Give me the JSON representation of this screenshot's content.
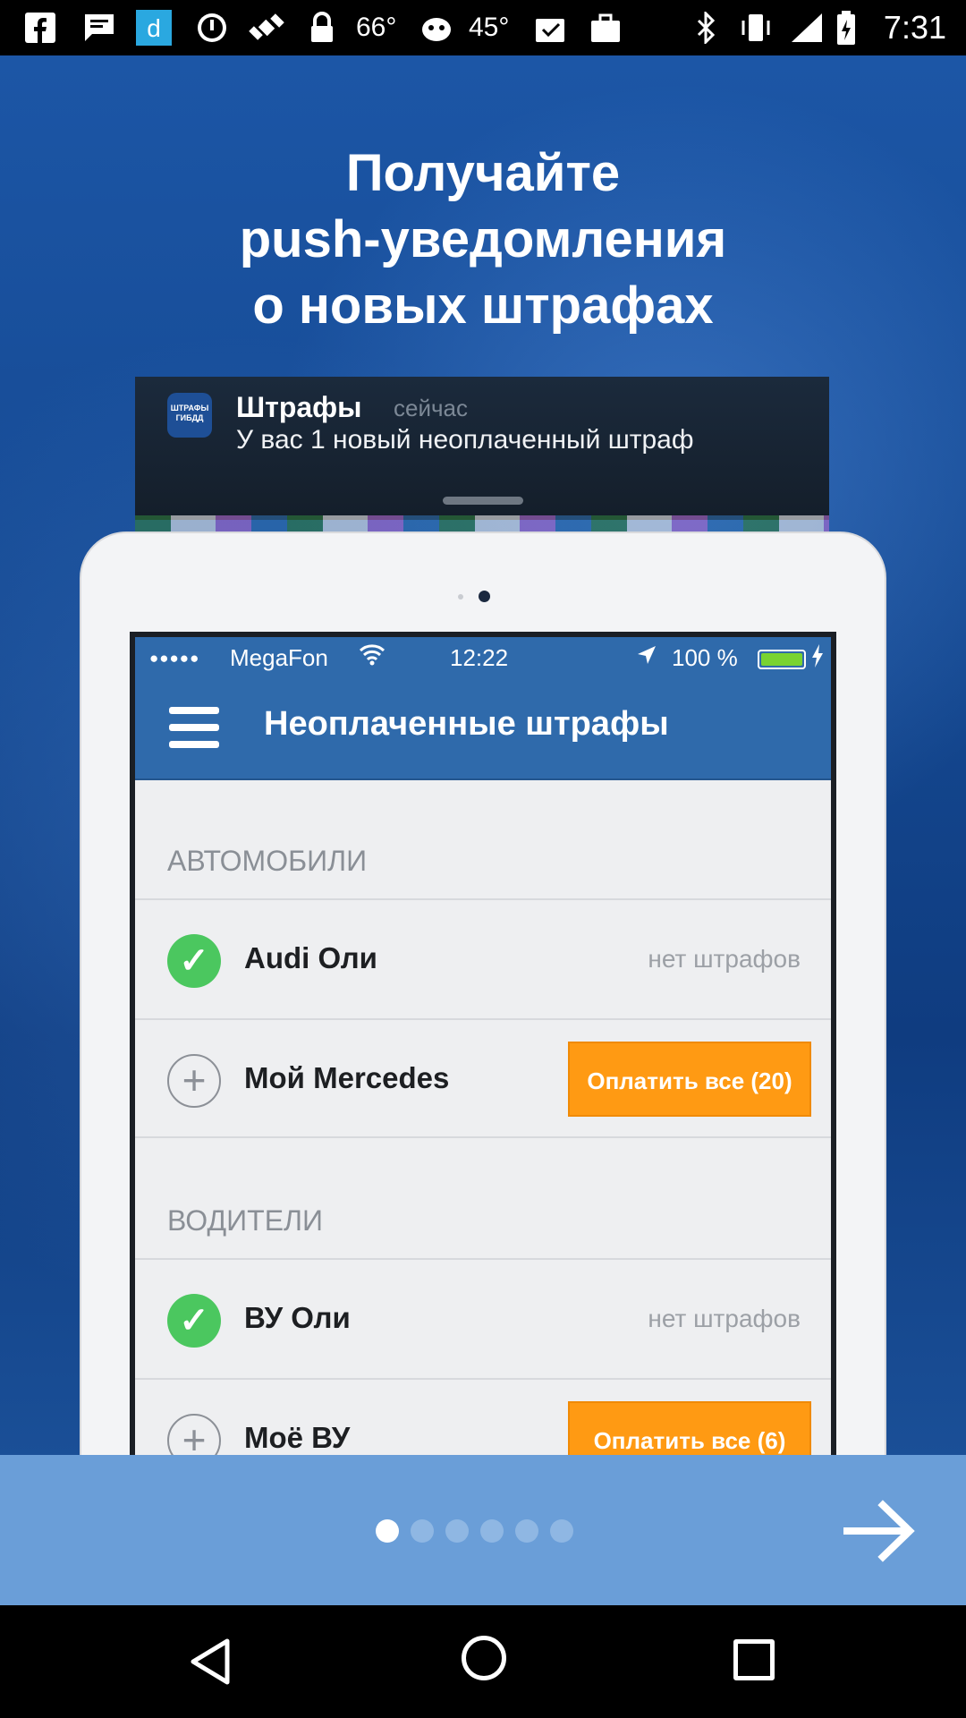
{
  "status_bar": {
    "temp1": "66°",
    "temp2": "45°",
    "time": "7:31",
    "icons": [
      "facebook-icon",
      "message-icon",
      "d-app-icon",
      "alarm-icon",
      "satellite-icon",
      "lock-icon",
      "weather-icon",
      "game-icon",
      "clipboard-icon",
      "bag-icon",
      "bluetooth-icon",
      "vibrate-icon",
      "signal-icon",
      "battery-icon"
    ]
  },
  "headline": {
    "line1": "Получайте",
    "line2": "push-уведомления",
    "line3": "о новых штрафах"
  },
  "notification": {
    "app_icon_text": "ШТРАФЫ ГИБДД",
    "title": "Штрафы",
    "time": "сейчас",
    "body": "У вас 1 новый неоплаченный штраф"
  },
  "device_screen": {
    "status": {
      "dots": "●●●●●",
      "carrier": "MegaFon",
      "time": "12:22",
      "battery": "100 %"
    },
    "title": "Неоплаченные штрафы",
    "sections": [
      {
        "header": "АВТОМОБИЛИ",
        "rows": [
          {
            "label": "Audi Оли",
            "status": "нет штрафов",
            "checked": true
          },
          {
            "label": "Мой Mercedes",
            "action": "Оплатить все (20)",
            "checked": false
          }
        ]
      },
      {
        "header": "ВОДИТЕЛИ",
        "rows": [
          {
            "label": "ВУ Оли",
            "status": "нет штрафов",
            "checked": true
          },
          {
            "label": "Моё ВУ",
            "action": "Оплатить все (6)",
            "checked": false
          }
        ]
      }
    ]
  },
  "pager": {
    "count": 6,
    "active_index": 0
  },
  "next_label": "→",
  "colors": {
    "accent_blue": "#2f6aab",
    "bottom_bar": "#6a9ed8",
    "pay_orange": "#ff9a13",
    "check_green": "#4bc75f"
  }
}
